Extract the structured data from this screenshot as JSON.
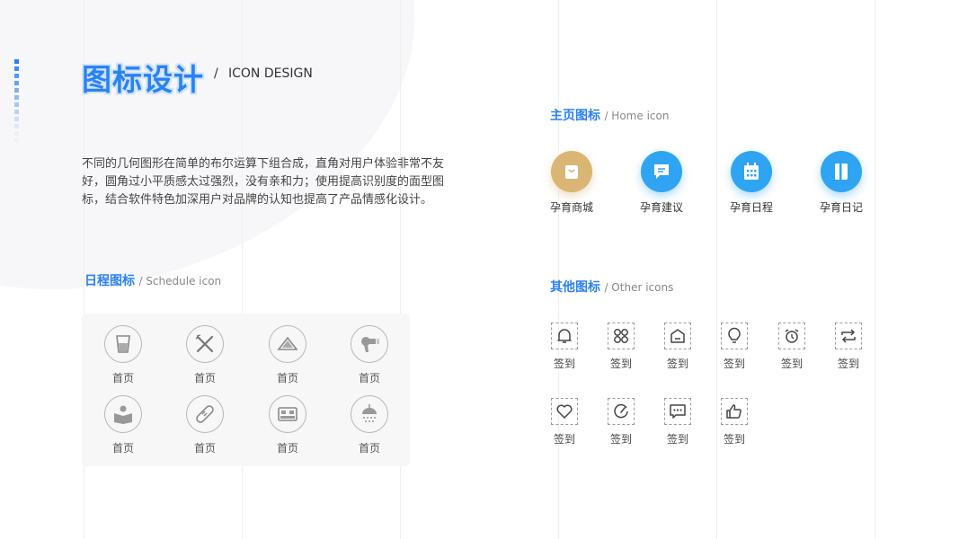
{
  "header": {
    "title_cn": "图标设计",
    "separator": "/",
    "title_en": "ICON DESIGN"
  },
  "description": "不同的几何图形在简单的布尔运算下组合成，直角对用户体验非常不友好，圆角过小平质感太过强烈，没有亲和力；使用提高识别度的面型图标，结合软件特色加深用户对品牌的认知也提高了产品情感化设计。",
  "schedule": {
    "heading_cn": "日程图标",
    "heading_en": "/ Schedule icon",
    "items": [
      {
        "icon": "cup-icon",
        "label": "首页"
      },
      {
        "icon": "fork-knife-icon",
        "label": "首页"
      },
      {
        "icon": "watermelon-icon",
        "label": "首页"
      },
      {
        "icon": "hair-dryer-icon",
        "label": "首页"
      },
      {
        "icon": "reading-icon",
        "label": "首页"
      },
      {
        "icon": "pill-icon",
        "label": "首页"
      },
      {
        "icon": "bed-icon",
        "label": "首页"
      },
      {
        "icon": "shower-icon",
        "label": "首页"
      }
    ]
  },
  "home": {
    "heading_cn": "主页图标",
    "heading_en": "/ Home icon",
    "items": [
      {
        "icon": "shopping-bag-icon",
        "label": "孕育商城",
        "color": "#d9b673"
      },
      {
        "icon": "chat-icon",
        "label": "孕育建议",
        "color": "#2fa4f2"
      },
      {
        "icon": "calendar-icon",
        "label": "孕育日程",
        "color": "#2fa4f2"
      },
      {
        "icon": "diary-icon",
        "label": "孕育日记",
        "color": "#2fa4f2"
      }
    ]
  },
  "other": {
    "heading_cn": "其他图标",
    "heading_en": "/ Other icons",
    "items": [
      {
        "icon": "bell-icon",
        "label": "签到"
      },
      {
        "icon": "grid-icon",
        "label": "签到"
      },
      {
        "icon": "home-icon",
        "label": "签到"
      },
      {
        "icon": "bulb-icon",
        "label": "签到"
      },
      {
        "icon": "alarm-icon",
        "label": "签到"
      },
      {
        "icon": "repeat-icon",
        "label": "签到"
      },
      {
        "icon": "heart-icon",
        "label": "签到"
      },
      {
        "icon": "gauge-icon",
        "label": "签到"
      },
      {
        "icon": "message-icon",
        "label": "签到"
      },
      {
        "icon": "thumbs-up-icon",
        "label": "签到"
      }
    ]
  },
  "colors": {
    "accent": "#2a82f2",
    "gold": "#d9b673",
    "home_blue": "#2fa4f2"
  }
}
